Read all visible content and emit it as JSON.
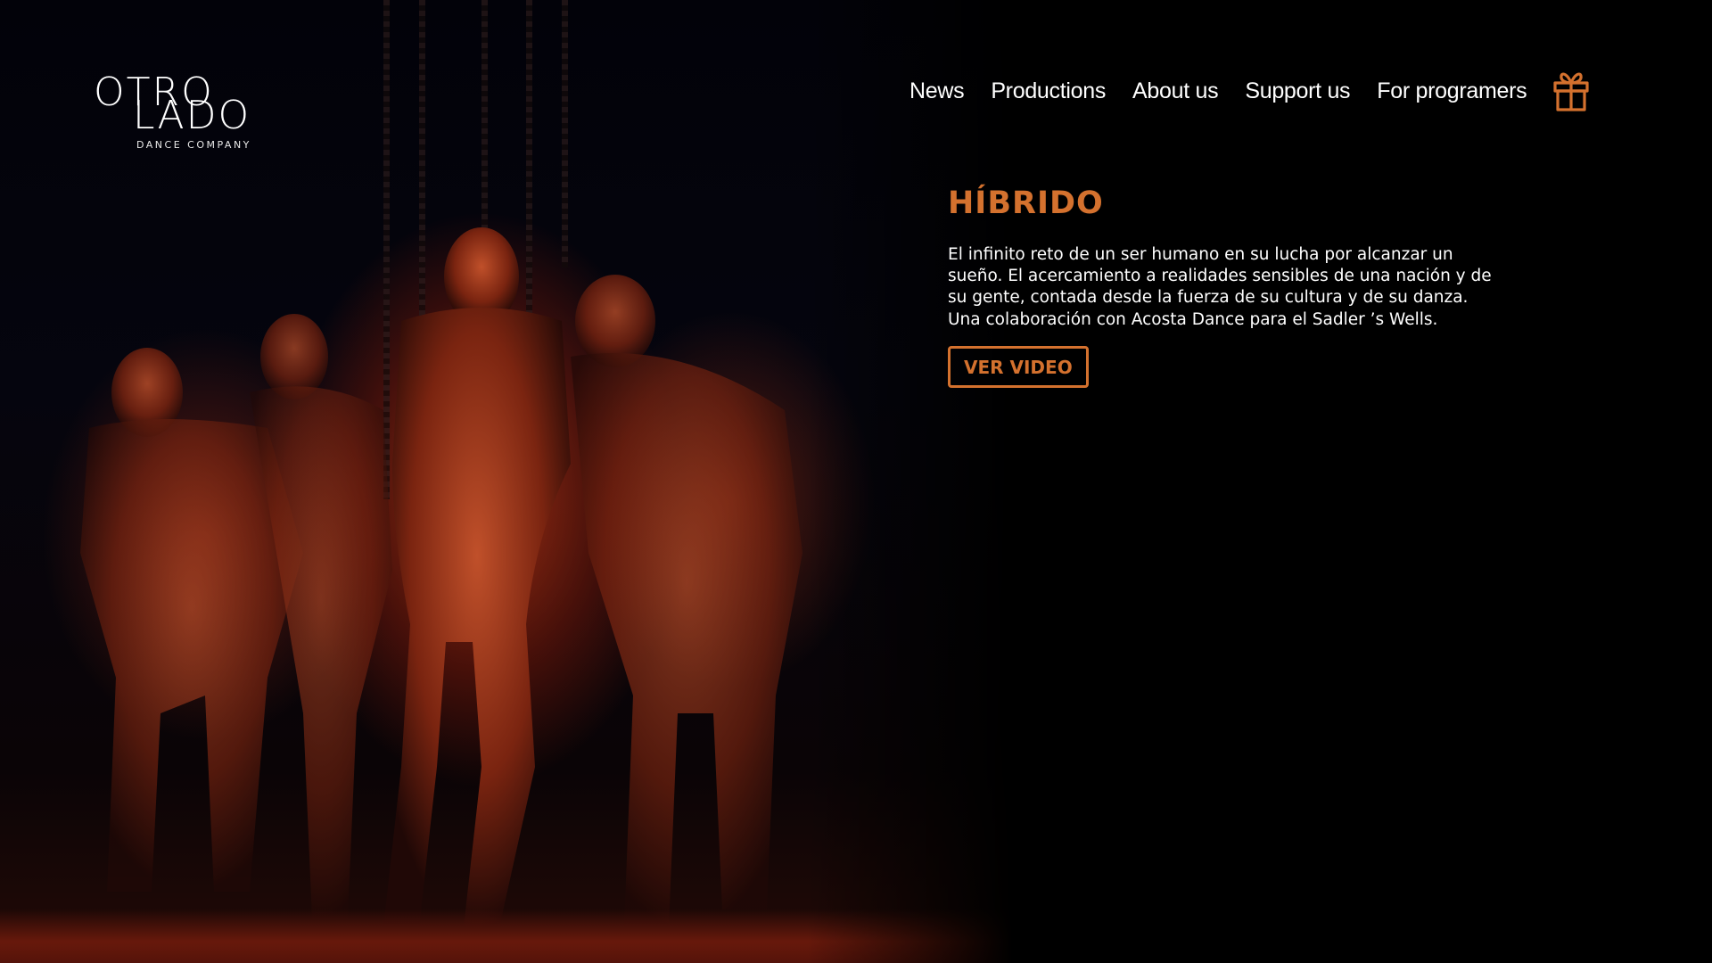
{
  "brand": {
    "logo_line1": "OTRO",
    "logo_line2": "LADO",
    "logo_subtitle": "DANCE COMPANY"
  },
  "nav": {
    "items": [
      {
        "label": "News"
      },
      {
        "label": "Productions"
      },
      {
        "label": "About us"
      },
      {
        "label": "Support us"
      },
      {
        "label": "For programers"
      }
    ],
    "gift_icon": "gift-icon"
  },
  "feature": {
    "title": "HÍBRIDO",
    "description": "El infinito reto de un ser humano en su lucha por alcanzar un sueño. El acercamiento a realidades sensibles de una nación y de su gente, contada desde la fuerza de su cultura y de su danza. Una colaboración con Acosta Dance para el Sadler ’s Wells.",
    "button_label": "VER VIDEO"
  },
  "colors": {
    "accent": "#d4712e",
    "background": "#000000",
    "text": "#ffffff"
  }
}
